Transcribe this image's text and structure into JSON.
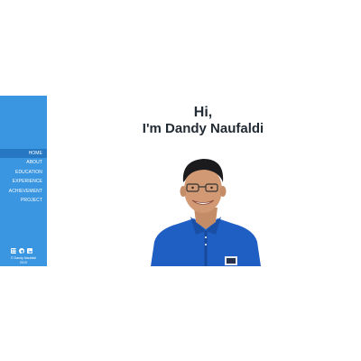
{
  "sidebar": {
    "nav": [
      {
        "label": "HOME",
        "active": true
      },
      {
        "label": "ABOUT",
        "active": false
      },
      {
        "label": "EDUCATION",
        "active": false
      },
      {
        "label": "EXPERIENCE",
        "active": false
      },
      {
        "label": "ACHIEVEMENT",
        "active": false
      },
      {
        "label": "PROJECT",
        "active": false
      }
    ],
    "social_icons": [
      "mail-icon",
      "github-icon",
      "linkedin-icon"
    ],
    "copyright_line1": "© Dandy Naufaldi",
    "copyright_line2": "2019"
  },
  "hero": {
    "greeting": "Hi,",
    "name_line": "I'm Dandy Naufaldi"
  },
  "colors": {
    "sidebar_bg": "#3a96e0",
    "active_nav_bg": "#2678c2",
    "heading_text": "#222b33",
    "shirt": "#1f5fc4"
  }
}
